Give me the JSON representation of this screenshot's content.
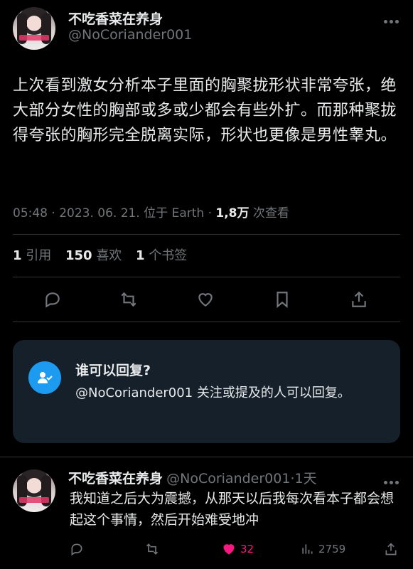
{
  "tweet": {
    "display_name": "不吃香菜在养身",
    "handle": "@NoCoriander001",
    "text": "上次看到激女分析本子里面的胸聚拢形状非常夸张，绝大部分女性的胸部或多或少都会有些外扩。而那种聚拢得夸张的胸形完全脱离实际，形状也更像是男性睾丸。",
    "time": "05:48",
    "date": "2023. 06. 21.",
    "location": "位于 Earth",
    "views": "1,8万",
    "views_label": "次查看",
    "quotes_count": "1",
    "quotes_label": "引用",
    "likes_count": "150",
    "likes_label": "喜欢",
    "bookmarks_count": "1",
    "bookmarks_label": "个书签",
    "separator": "·"
  },
  "reply_settings": {
    "title": "谁可以回复?",
    "description": "@NoCoriander001 关注或提及的人可以回复。"
  },
  "reply": {
    "display_name": "不吃香菜在养身",
    "handle": "@NoCoriander001",
    "age": "1天",
    "separator": "·",
    "text": "我知道之后大为震撼，从那天以后我每次看本子都会想起这个事情，然后开始难受地冲",
    "likes": "32",
    "views": "2759"
  },
  "icons": [
    "more-icon",
    "reply-icon",
    "retweet-icon",
    "like-icon",
    "bookmark-icon",
    "share-icon",
    "views-icon",
    "person-check-icon"
  ],
  "colors": {
    "accent": "#1d9bf0",
    "like": "#f91880",
    "muted": "#71767b",
    "background": "#000000",
    "card": "#16202a"
  }
}
